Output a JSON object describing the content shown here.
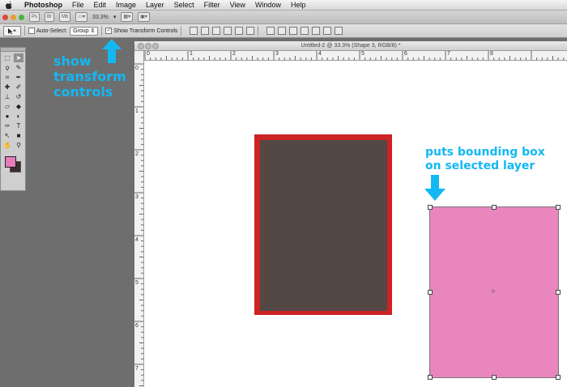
{
  "menubar": {
    "items": [
      "Photoshop",
      "File",
      "Edit",
      "Image",
      "Layer",
      "Select",
      "Filter",
      "View",
      "Window",
      "Help"
    ]
  },
  "appbar": {
    "ps_label": "Ps",
    "br_label": "Br",
    "mb_label": "Mb",
    "zoom": "33.3%"
  },
  "options": {
    "auto_select_label": "Auto-Select:",
    "auto_select_checked": false,
    "auto_select_value": "Group",
    "show_transform_label": "Show Transform Controls",
    "show_transform_checked": true
  },
  "document": {
    "title": "Untitled-2 @ 33.3% (Shape 3, RGB/8) *",
    "ruler_h": [
      "0",
      "1",
      "2",
      "3",
      "4",
      "5",
      "6",
      "7",
      "8"
    ],
    "ruler_v": [
      "0",
      "1",
      "2",
      "3",
      "4",
      "5",
      "6",
      "7"
    ]
  },
  "canvas": {
    "shape1_fill": "#534844",
    "shape1_stroke": "#cd2324",
    "shape2_fill": "#e986bd"
  },
  "tools": {
    "foreground": "#e57db8",
    "background": "#3b2f2b"
  },
  "annotations": {
    "show": [
      "show",
      "transform",
      "controls"
    ],
    "puts": [
      "puts bounding box",
      "on selected layer"
    ],
    "color": "#13b8f2"
  }
}
